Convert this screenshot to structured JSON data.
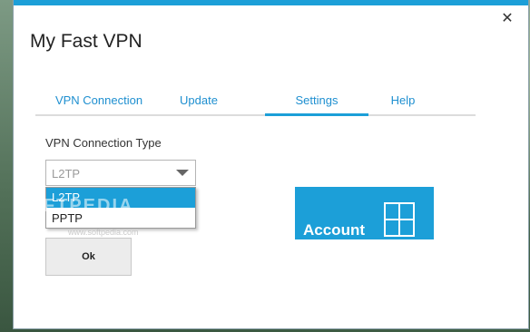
{
  "window": {
    "title": "My Fast VPN",
    "close_glyph": "✕"
  },
  "tabs": [
    {
      "label": "VPN Connection"
    },
    {
      "label": "Update"
    },
    {
      "label": "Settings",
      "active": true
    },
    {
      "label": "Help"
    }
  ],
  "settings": {
    "connection_type_label": "VPN Connection Type",
    "selected_value": "L2TP",
    "options": [
      "L2TP",
      "PPTP"
    ],
    "highlighted_option": "L2TP"
  },
  "buttons": {
    "ok_label": "Ok"
  },
  "account_tile": {
    "label": "Account",
    "icon": "windows-grid-icon"
  },
  "watermark": {
    "text": "SOFTPEDIA",
    "sub": "www.softpedia.com"
  },
  "colors": {
    "accent": "#1c9fd8",
    "tab_text": "#1e8fd0",
    "button_bg": "#ececec"
  }
}
